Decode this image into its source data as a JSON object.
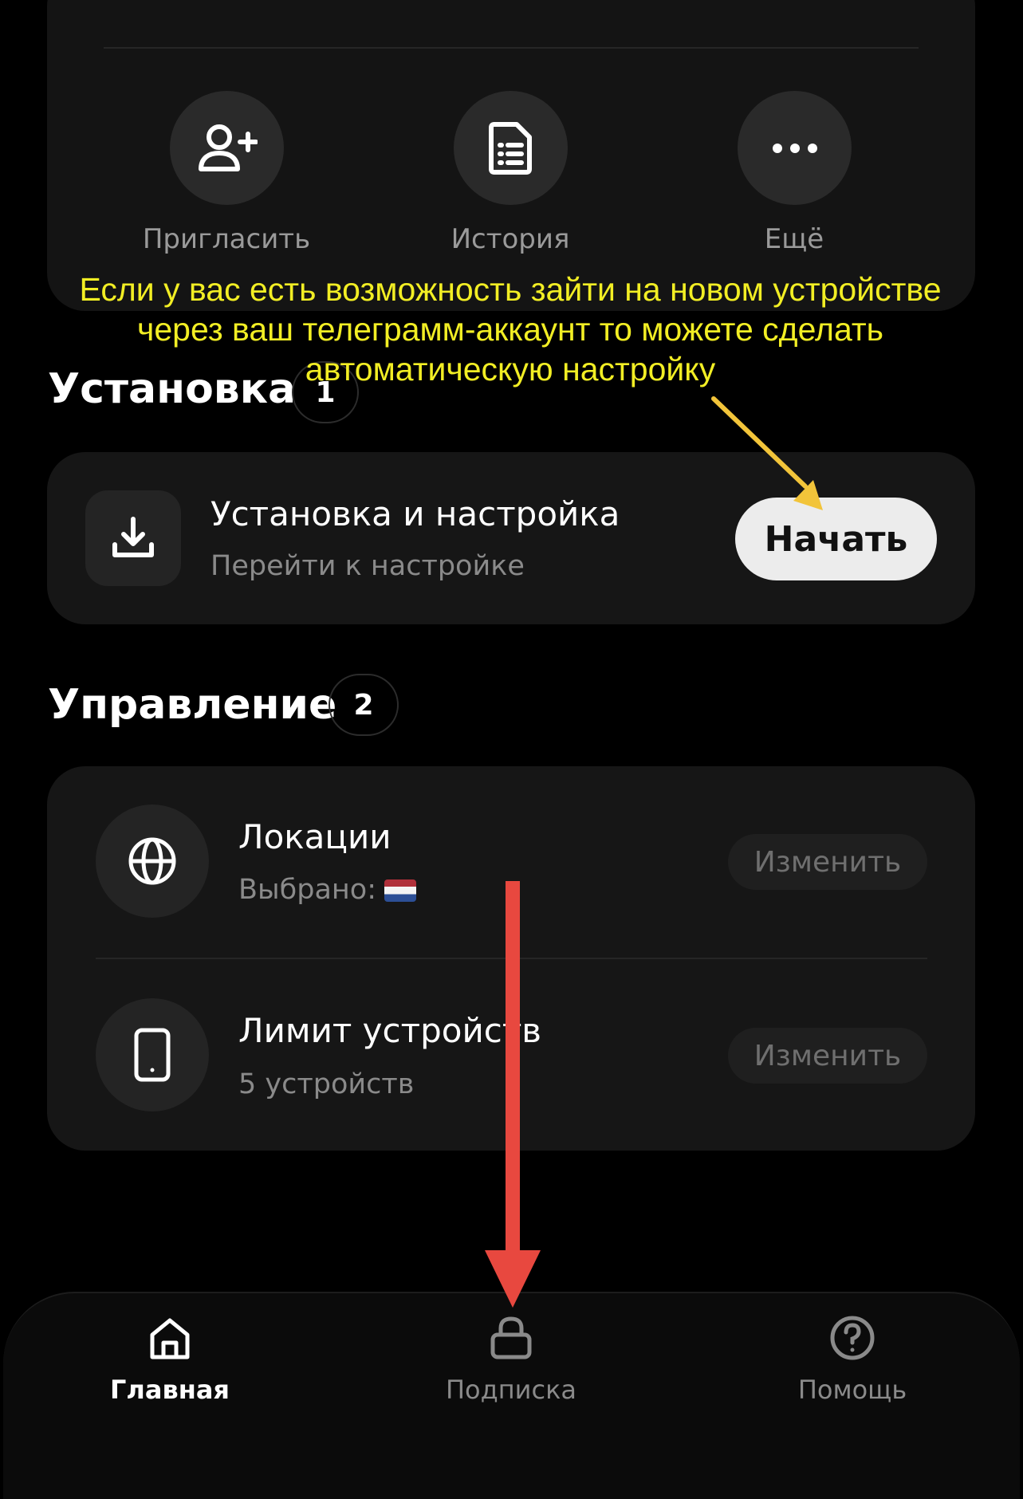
{
  "quick_actions": [
    {
      "label": "Пригласить",
      "icon": "add-user-icon"
    },
    {
      "label": "История",
      "icon": "document-list-icon"
    },
    {
      "label": "Ещё",
      "icon": "more-dots-icon"
    }
  ],
  "annotation": {
    "lines": [
      "Если у вас есть возможность зайти на новом устройстве",
      "через ваш телеграмм-аккаунт то можете сделать",
      "автоматическую настройку"
    ],
    "text_color": "#f2ee24",
    "arrow_color_yellow": "#f2c43a",
    "arrow_color_red": "#e8483f"
  },
  "install_section": {
    "title": "Установка",
    "count": "1",
    "row": {
      "icon": "download-icon",
      "title": "Установка и настройка",
      "subtitle": "Перейти к настройке",
      "button_label": "Начать"
    }
  },
  "manage_section": {
    "title": "Управление",
    "count": "2",
    "rows": [
      {
        "icon": "globe-icon",
        "title": "Локации",
        "subtitle": "Выбрано:",
        "flag": "netherlands-flag",
        "button_label": "Изменить"
      },
      {
        "icon": "phone-icon",
        "title": "Лимит устройств",
        "subtitle": "5 устройств",
        "button_label": "Изменить"
      }
    ]
  },
  "bottom_nav": {
    "items": [
      {
        "label": "Главная",
        "icon": "home-icon",
        "active": true
      },
      {
        "label": "Подписка",
        "icon": "lock-icon",
        "active": false
      },
      {
        "label": "Помощь",
        "icon": "help-icon",
        "active": false
      }
    ]
  }
}
